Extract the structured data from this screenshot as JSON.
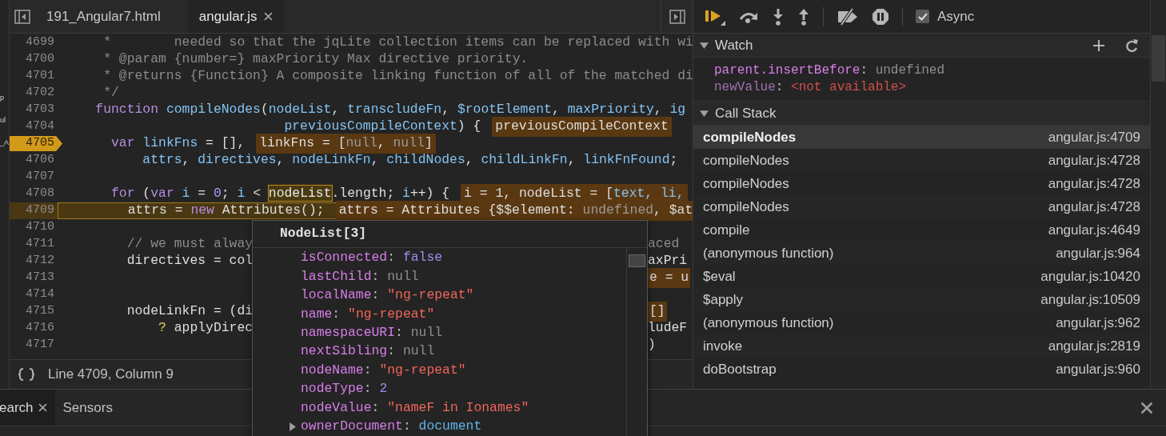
{
  "left_edge_fragments": [
    "p",
    "ul",
    "_A"
  ],
  "editor_tabs": [
    {
      "label": "191_Angular7.html",
      "selected": false,
      "closable": false
    },
    {
      "label": "angular.js",
      "selected": true,
      "closable": true
    }
  ],
  "code_lines": [
    {
      "number": "4699",
      "breakpoint": false,
      "current": false,
      "code": [
        {
          "kind": "comment",
          "text": "     *        needed so that the jqLite collection items can be replaced with wi"
        }
      ]
    },
    {
      "number": "4700",
      "breakpoint": false,
      "current": false,
      "code": [
        {
          "kind": "comment",
          "text": "     * @param {number=} maxPriority Max directive priority."
        }
      ]
    },
    {
      "number": "4701",
      "breakpoint": false,
      "current": false,
      "code": [
        {
          "kind": "comment",
          "text": "     * @returns {Function} A composite linking function of all of the matched di"
        }
      ]
    },
    {
      "number": "4702",
      "breakpoint": false,
      "current": false,
      "code": [
        {
          "kind": "comment",
          "text": "     */"
        }
      ]
    },
    {
      "number": "4703",
      "breakpoint": false,
      "current": false,
      "code": [
        {
          "kind": "keyword",
          "text": "    function"
        },
        {
          "kind": "ident",
          "text": " compileNodes"
        },
        {
          "kind": "plain",
          "text": "("
        },
        {
          "kind": "ident",
          "text": "nodeList"
        },
        {
          "kind": "plain",
          "text": ", "
        },
        {
          "kind": "ident",
          "text": "transcludeFn"
        },
        {
          "kind": "plain",
          "text": ", "
        },
        {
          "kind": "ident",
          "text": "$rootElement"
        },
        {
          "kind": "plain",
          "text": ", "
        },
        {
          "kind": "ident",
          "text": "maxPriority"
        },
        {
          "kind": "plain",
          "text": ", "
        },
        {
          "kind": "ident",
          "text": "ig"
        }
      ]
    },
    {
      "number": "4704",
      "breakpoint": false,
      "current": false,
      "code": [
        {
          "kind": "ident",
          "text": "                            previousCompileContext"
        },
        {
          "kind": "plain",
          "text": ") {"
        }
      ],
      "value": [
        {
          "kind": "plain",
          "text": "previousCompileContext"
        }
      ]
    },
    {
      "number": "4705",
      "breakpoint": true,
      "current": false,
      "code": [
        {
          "kind": "keyword",
          "text": "      var"
        },
        {
          "kind": "ident",
          "text": " linkFns"
        },
        {
          "kind": "plain",
          "text": " = [],"
        }
      ],
      "value": [
        {
          "kind": "plain",
          "text": "linkFns = ["
        },
        {
          "kind": "null",
          "text": "null"
        },
        {
          "kind": "plain",
          "text": ", "
        },
        {
          "kind": "null",
          "text": "null"
        },
        {
          "kind": "plain",
          "text": "]"
        }
      ]
    },
    {
      "number": "4706",
      "breakpoint": false,
      "current": false,
      "code": [
        {
          "kind": "ident",
          "text": "          attrs"
        },
        {
          "kind": "plain",
          "text": ", "
        },
        {
          "kind": "ident",
          "text": "directives"
        },
        {
          "kind": "plain",
          "text": ", "
        },
        {
          "kind": "ident",
          "text": "nodeLinkFn"
        },
        {
          "kind": "plain",
          "text": ", "
        },
        {
          "kind": "ident",
          "text": "childNodes"
        },
        {
          "kind": "plain",
          "text": ", "
        },
        {
          "kind": "ident",
          "text": "childLinkFn"
        },
        {
          "kind": "plain",
          "text": ", "
        },
        {
          "kind": "ident",
          "text": "linkFnFound"
        },
        {
          "kind": "plain",
          "text": ";"
        }
      ]
    },
    {
      "number": "4707",
      "breakpoint": false,
      "current": false
    },
    {
      "number": "4708",
      "breakpoint": false,
      "current": false,
      "code": [
        {
          "kind": "keyword",
          "text": "      for"
        },
        {
          "kind": "plain",
          "text": " ("
        },
        {
          "kind": "keyword",
          "text": "var"
        },
        {
          "kind": "ident",
          "text": " i"
        },
        {
          "kind": "plain",
          "text": " = "
        },
        {
          "kind": "number",
          "text": "0"
        },
        {
          "kind": "plain",
          "text": "; "
        },
        {
          "kind": "ident",
          "text": "i"
        },
        {
          "kind": "plain",
          "text": " < "
        },
        {
          "kind": "hover",
          "text": "nodeList"
        },
        {
          "kind": "plain",
          "text": ".length; "
        },
        {
          "kind": "ident",
          "text": "i"
        },
        {
          "kind": "plain",
          "text": "++) {"
        }
      ],
      "value": [
        {
          "kind": "plain",
          "text": "i = 1, nodeList = ["
        },
        {
          "kind": "ident",
          "text": "text, li,"
        }
      ]
    },
    {
      "number": "4709",
      "breakpoint": false,
      "current": true,
      "code": [
        {
          "kind": "plain",
          "text": "        attrs = "
        },
        {
          "kind": "keyword",
          "text": "new"
        },
        {
          "kind": "plain",
          "text": " Attributes();"
        }
      ],
      "value": [
        {
          "kind": "plain",
          "text": "attrs = Attributes {$$element: "
        },
        {
          "kind": "null",
          "text": "undefined"
        },
        {
          "kind": "plain",
          "text": ", $at"
        }
      ]
    },
    {
      "number": "4710",
      "breakpoint": false,
      "current": false
    },
    {
      "number": "4711",
      "breakpoint": false,
      "current": false,
      "code": [
        {
          "kind": "comment",
          "text": "        // we must alway"
        }
      ],
      "right_code": [
        {
          "kind": "comment",
          "text": "aced"
        }
      ]
    },
    {
      "number": "4712",
      "breakpoint": false,
      "current": false,
      "code": [
        {
          "kind": "plain",
          "text": "        directives = col"
        }
      ],
      "right_code": [
        {
          "kind": "plain",
          "text": "axPri"
        }
      ]
    },
    {
      "number": "4713",
      "breakpoint": false,
      "current": false,
      "right_value": [
        {
          "kind": "plain",
          "text": "e = u"
        }
      ]
    },
    {
      "number": "4714",
      "breakpoint": false,
      "current": false
    },
    {
      "number": "4715",
      "breakpoint": false,
      "current": false,
      "code": [
        {
          "kind": "plain",
          "text": "        nodeLinkFn = (di"
        }
      ],
      "right_value": [
        {
          "kind": "plain",
          "text": "[]"
        }
      ]
    },
    {
      "number": "4716",
      "breakpoint": false,
      "current": false,
      "code": [
        {
          "kind": "operator",
          "text": "            ?"
        },
        {
          "kind": "plain",
          "text": " applyDirec"
        }
      ],
      "right_code": [
        {
          "kind": "plain",
          "text": "ludeF"
        }
      ]
    },
    {
      "number": "4717",
      "breakpoint": false,
      "current": false,
      "right_code": [
        {
          "kind": "plain",
          "text": ")"
        }
      ]
    }
  ],
  "status_bar": {
    "position": "Line 4709, Column 9"
  },
  "popover": {
    "title": "NodeList[3]",
    "entries": [
      {
        "key": "isConnected",
        "separator": ":",
        "value": "false",
        "kind": "boolean",
        "expandable": false
      },
      {
        "key": "lastChild",
        "separator": ":",
        "value": "null",
        "kind": "null",
        "expandable": false
      },
      {
        "key": "localName",
        "separator": ":",
        "value": "\"ng-repeat\"",
        "kind": "string",
        "expandable": false
      },
      {
        "key": "name",
        "separator": ":",
        "value": "\"ng-repeat\"",
        "kind": "string",
        "expandable": false
      },
      {
        "key": "namespaceURI",
        "separator": ":",
        "value": "null",
        "kind": "null",
        "expandable": false
      },
      {
        "key": "nextSibling",
        "separator": ":",
        "value": "null",
        "kind": "null",
        "expandable": false
      },
      {
        "key": "nodeName",
        "separator": ":",
        "value": "\"ng-repeat\"",
        "kind": "string",
        "expandable": false
      },
      {
        "key": "nodeType",
        "separator": ":",
        "value": "2",
        "kind": "number",
        "expandable": false
      },
      {
        "key": "nodeValue",
        "separator": ":",
        "value": "\"nameF in Ionames\"",
        "kind": "string",
        "expandable": false
      },
      {
        "key": "ownerDocument",
        "separator": ":",
        "value": "document",
        "kind": "object",
        "expandable": true
      }
    ]
  },
  "debugger": {
    "async": {
      "label": "Async",
      "checked": true
    },
    "watch": {
      "title": "Watch",
      "expanded": true,
      "items": [
        {
          "expression": "parent.insertBefore",
          "separator": ":",
          "value": "undefined",
          "kind": "undefined"
        },
        {
          "expression": "newValue",
          "separator": ":",
          "value": "<not available>",
          "kind": "unavailable"
        }
      ]
    },
    "call_stack": {
      "title": "Call Stack",
      "expanded": true,
      "frames": [
        {
          "name": "compileNodes",
          "location": "angular.js:4709",
          "selected": true
        },
        {
          "name": "compileNodes",
          "location": "angular.js:4728",
          "selected": false
        },
        {
          "name": "compileNodes",
          "location": "angular.js:4728",
          "selected": false
        },
        {
          "name": "compileNodes",
          "location": "angular.js:4728",
          "selected": false
        },
        {
          "name": "compile",
          "location": "angular.js:4649",
          "selected": false
        },
        {
          "name": "(anonymous function)",
          "location": "angular.js:964",
          "selected": false
        },
        {
          "name": "$eval",
          "location": "angular.js:10420",
          "selected": false
        },
        {
          "name": "$apply",
          "location": "angular.js:10509",
          "selected": false
        },
        {
          "name": "(anonymous function)",
          "location": "angular.js:962",
          "selected": false
        },
        {
          "name": "invoke",
          "location": "angular.js:2819",
          "selected": false
        },
        {
          "name": "doBootstrap",
          "location": "angular.js:960",
          "selected": false
        }
      ]
    }
  },
  "drawer_tabs": [
    {
      "label": "earch",
      "selected": true,
      "closable": true
    },
    {
      "label": "Sensors",
      "selected": false,
      "closable": false
    }
  ]
}
